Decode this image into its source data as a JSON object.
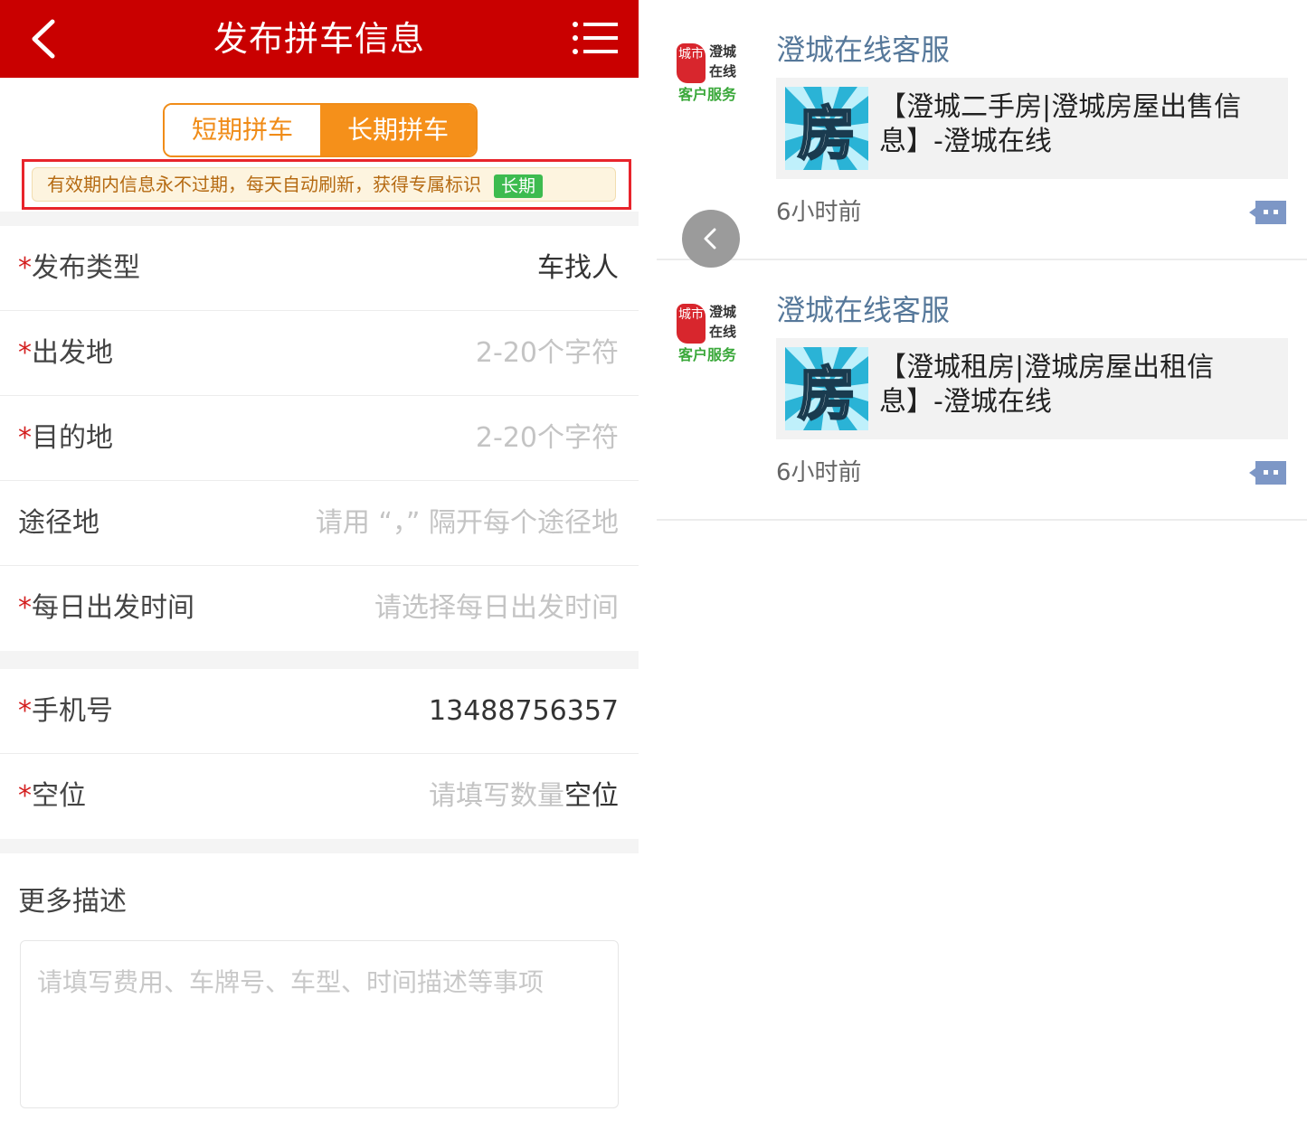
{
  "header": {
    "title": "发布拼车信息",
    "back_icon": "chevron-left-icon",
    "menu_icon": "hamburger-menu-icon",
    "bg_color": "#c90000"
  },
  "tabs": [
    {
      "label": "短期拼车",
      "active": false
    },
    {
      "label": "长期拼车",
      "active": true
    }
  ],
  "notice": {
    "text": "有效期内信息永不过期，每天自动刷新，获得专属标识",
    "badge": "长期"
  },
  "form": {
    "required_mark": "*",
    "group1": [
      {
        "label": "发布类型",
        "required": true,
        "value": "车找人",
        "placeholder": ""
      },
      {
        "label": "出发地",
        "required": true,
        "value": "",
        "placeholder": "2-20个字符"
      },
      {
        "label": "目的地",
        "required": true,
        "value": "",
        "placeholder": "2-20个字符"
      },
      {
        "label": "途径地",
        "required": false,
        "value": "",
        "placeholder": "请用 “，” 隔开每个途径地"
      },
      {
        "label": "每日出发时间",
        "required": true,
        "value": "",
        "placeholder": "请选择每日出发时间"
      }
    ],
    "group2": [
      {
        "label": "手机号",
        "required": true,
        "value": "13488756357",
        "placeholder": ""
      },
      {
        "label": "空位",
        "required": true,
        "value": "",
        "placeholder": "请填写数量",
        "unit": "空位"
      }
    ],
    "more": {
      "label": "更多描述",
      "placeholder": "请填写费用、车牌号、车型、时间描述等事项"
    }
  },
  "chat": {
    "avatar": {
      "seal": "城市",
      "line1": "澄城",
      "line2": "在线",
      "line3": "客户服务"
    },
    "messages": [
      {
        "sender": "澄城在线客服",
        "thumb_char": "房",
        "text": "【澄城二手房|澄城房屋出售信息】-澄城在线",
        "time": "6小时前"
      },
      {
        "sender": "澄城在线客服",
        "thumb_char": "房",
        "text": "【澄城租房|澄城房屋出租信息】-澄城在线",
        "time": "6小时前"
      }
    ],
    "comment_icon": "comment-icon",
    "collapse_icon": "chevron-left-icon"
  }
}
